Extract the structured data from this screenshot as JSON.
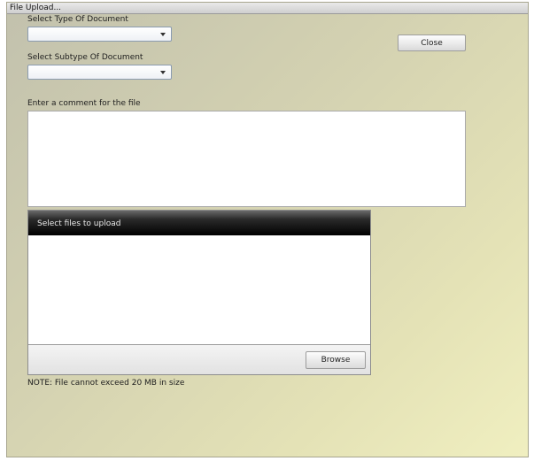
{
  "window": {
    "title": "File Upload..."
  },
  "document_type": {
    "label": "Select Type Of Document",
    "value": ""
  },
  "document_subtype": {
    "label": "Select Subtype Of Document",
    "value": ""
  },
  "comment": {
    "label": "Enter a comment for the file",
    "value": ""
  },
  "close_button": {
    "label": "Close"
  },
  "uploader": {
    "header": "Select files to upload",
    "browse_label": "Browse"
  },
  "note": "NOTE: File cannot exceed 20 MB in size"
}
